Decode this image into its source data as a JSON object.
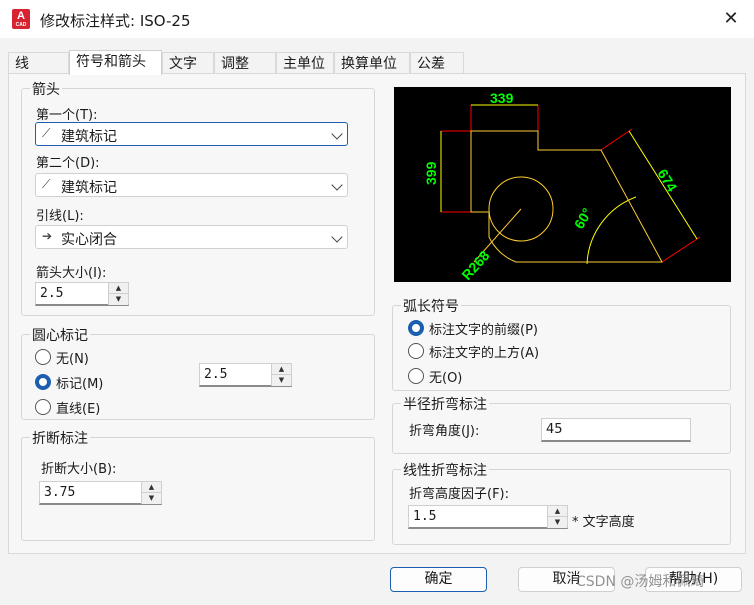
{
  "window": {
    "title": "修改标注样式: ISO-25",
    "close_glyph": "✕",
    "icon_text": "A",
    "icon_subtext": "CAD"
  },
  "tabs": [
    {
      "label": "线"
    },
    {
      "label": "符号和箭头"
    },
    {
      "label": "文字"
    },
    {
      "label": "调整"
    },
    {
      "label": "主单位"
    },
    {
      "label": "换算单位"
    },
    {
      "label": "公差"
    }
  ],
  "arrowheads": {
    "legend": "箭头",
    "first_label": "第一个(T):",
    "first_value": "建筑标记",
    "second_label": "第二个(D):",
    "second_value": "建筑标记",
    "leader_label": "引线(L):",
    "leader_value": "实心闭合",
    "size_label": "箭头大小(I):",
    "size_value": "2.5",
    "icons": {
      "tick": "architectural-tick-icon",
      "arrow": "closed-filled-arrow-icon"
    }
  },
  "center_marks": {
    "legend": "圆心标记",
    "options": [
      "无(N)",
      "标记(M)",
      "直线(E)"
    ],
    "selected": "标记(M)",
    "size_value": "2.5"
  },
  "break": {
    "legend": "折断标注",
    "size_label": "折断大小(B):",
    "size_value": "3.75"
  },
  "preview": {
    "dim_top": "339",
    "dim_left": "399",
    "dim_diag": "674",
    "dim_angle": "60°",
    "dim_radius": "R268"
  },
  "arc_length": {
    "legend": "弧长符号",
    "options": [
      "标注文字的前缀(P)",
      "标注文字的上方(A)",
      "无(O)"
    ],
    "selected": "标注文字的前缀(P)"
  },
  "radius_jog": {
    "legend": "半径折弯标注",
    "angle_label": "折弯角度(J):",
    "angle_value": "45"
  },
  "linear_jog": {
    "legend": "线性折弯标注",
    "height_label": "折弯高度因子(F):",
    "height_value": "1.5",
    "suffix": "* 文字高度"
  },
  "buttons": {
    "ok": "确定",
    "cancel": "取消",
    "help": "帮助(H)"
  },
  "watermark": "CSDN @汤姆和佩琦",
  "colors": {
    "accent": "#1b5fae",
    "preview_bg": "#000000",
    "dim_text": "#00ff00",
    "geometry": "#ffff00",
    "extension": "#ff0000"
  }
}
